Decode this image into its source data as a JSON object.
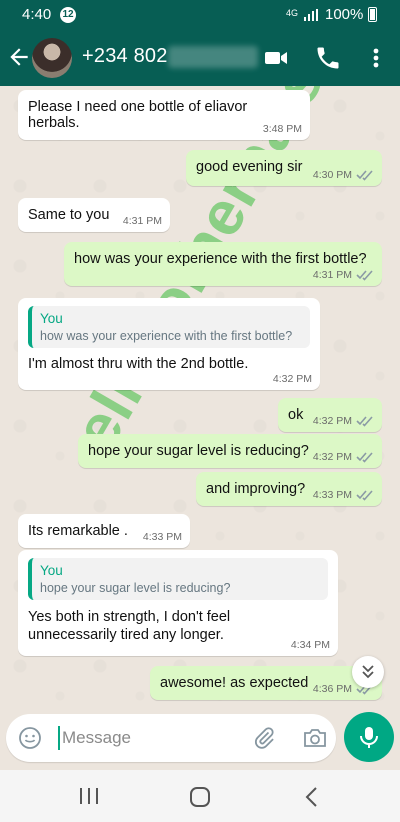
{
  "status_bar": {
    "time": "4:40",
    "notification_count": "12",
    "network": "4G",
    "battery": "100%"
  },
  "header": {
    "contact": "+234 802",
    "icons": [
      "back-arrow-icon",
      "video-call-icon",
      "phone-icon",
      "more-vert-icon"
    ]
  },
  "messages": [
    {
      "dir": "in",
      "text": "Please I need one bottle of eliavor herbals.",
      "time": "3:48 PM"
    },
    {
      "dir": "out",
      "text": "good evening sir",
      "time": "4:30 PM",
      "read": true
    },
    {
      "dir": "in",
      "text": "Same to you",
      "time": "4:31 PM"
    },
    {
      "dir": "out",
      "text": "how was your experience with the first bottle?",
      "time": "4:31 PM",
      "read": true
    },
    {
      "dir": "in",
      "quote_name": "You",
      "quote_text": "how was your experience with the first bottle?",
      "text": "I'm almost thru with the 2nd bottle.",
      "time": "4:32 PM"
    },
    {
      "dir": "out",
      "text": "ok",
      "time": "4:32 PM",
      "read": true
    },
    {
      "dir": "out",
      "text": "hope your sugar level is reducing?",
      "time": "4:32 PM",
      "read": true
    },
    {
      "dir": "out",
      "text": "and improving?",
      "time": "4:33 PM",
      "read": true
    },
    {
      "dir": "in",
      "text": "Its remarkable .",
      "time": "4:33 PM"
    },
    {
      "dir": "in",
      "quote_name": "You",
      "quote_text": "hope your sugar level is reducing?",
      "text": "Yes both in strength, I don't feel unnecessarily tired any longer.",
      "time": "4:34 PM"
    },
    {
      "dir": "out",
      "text": "awesome! as expected",
      "time": "4:36 PM",
      "read": true
    }
  ],
  "watermark": "eliavorherbals",
  "composer": {
    "placeholder": "Message"
  },
  "colors": {
    "header": "#075e54",
    "outgoing": "#dcf8c6",
    "incoming": "#ffffff",
    "accent": "#00a884",
    "read_tick": "#4fc3f7"
  }
}
